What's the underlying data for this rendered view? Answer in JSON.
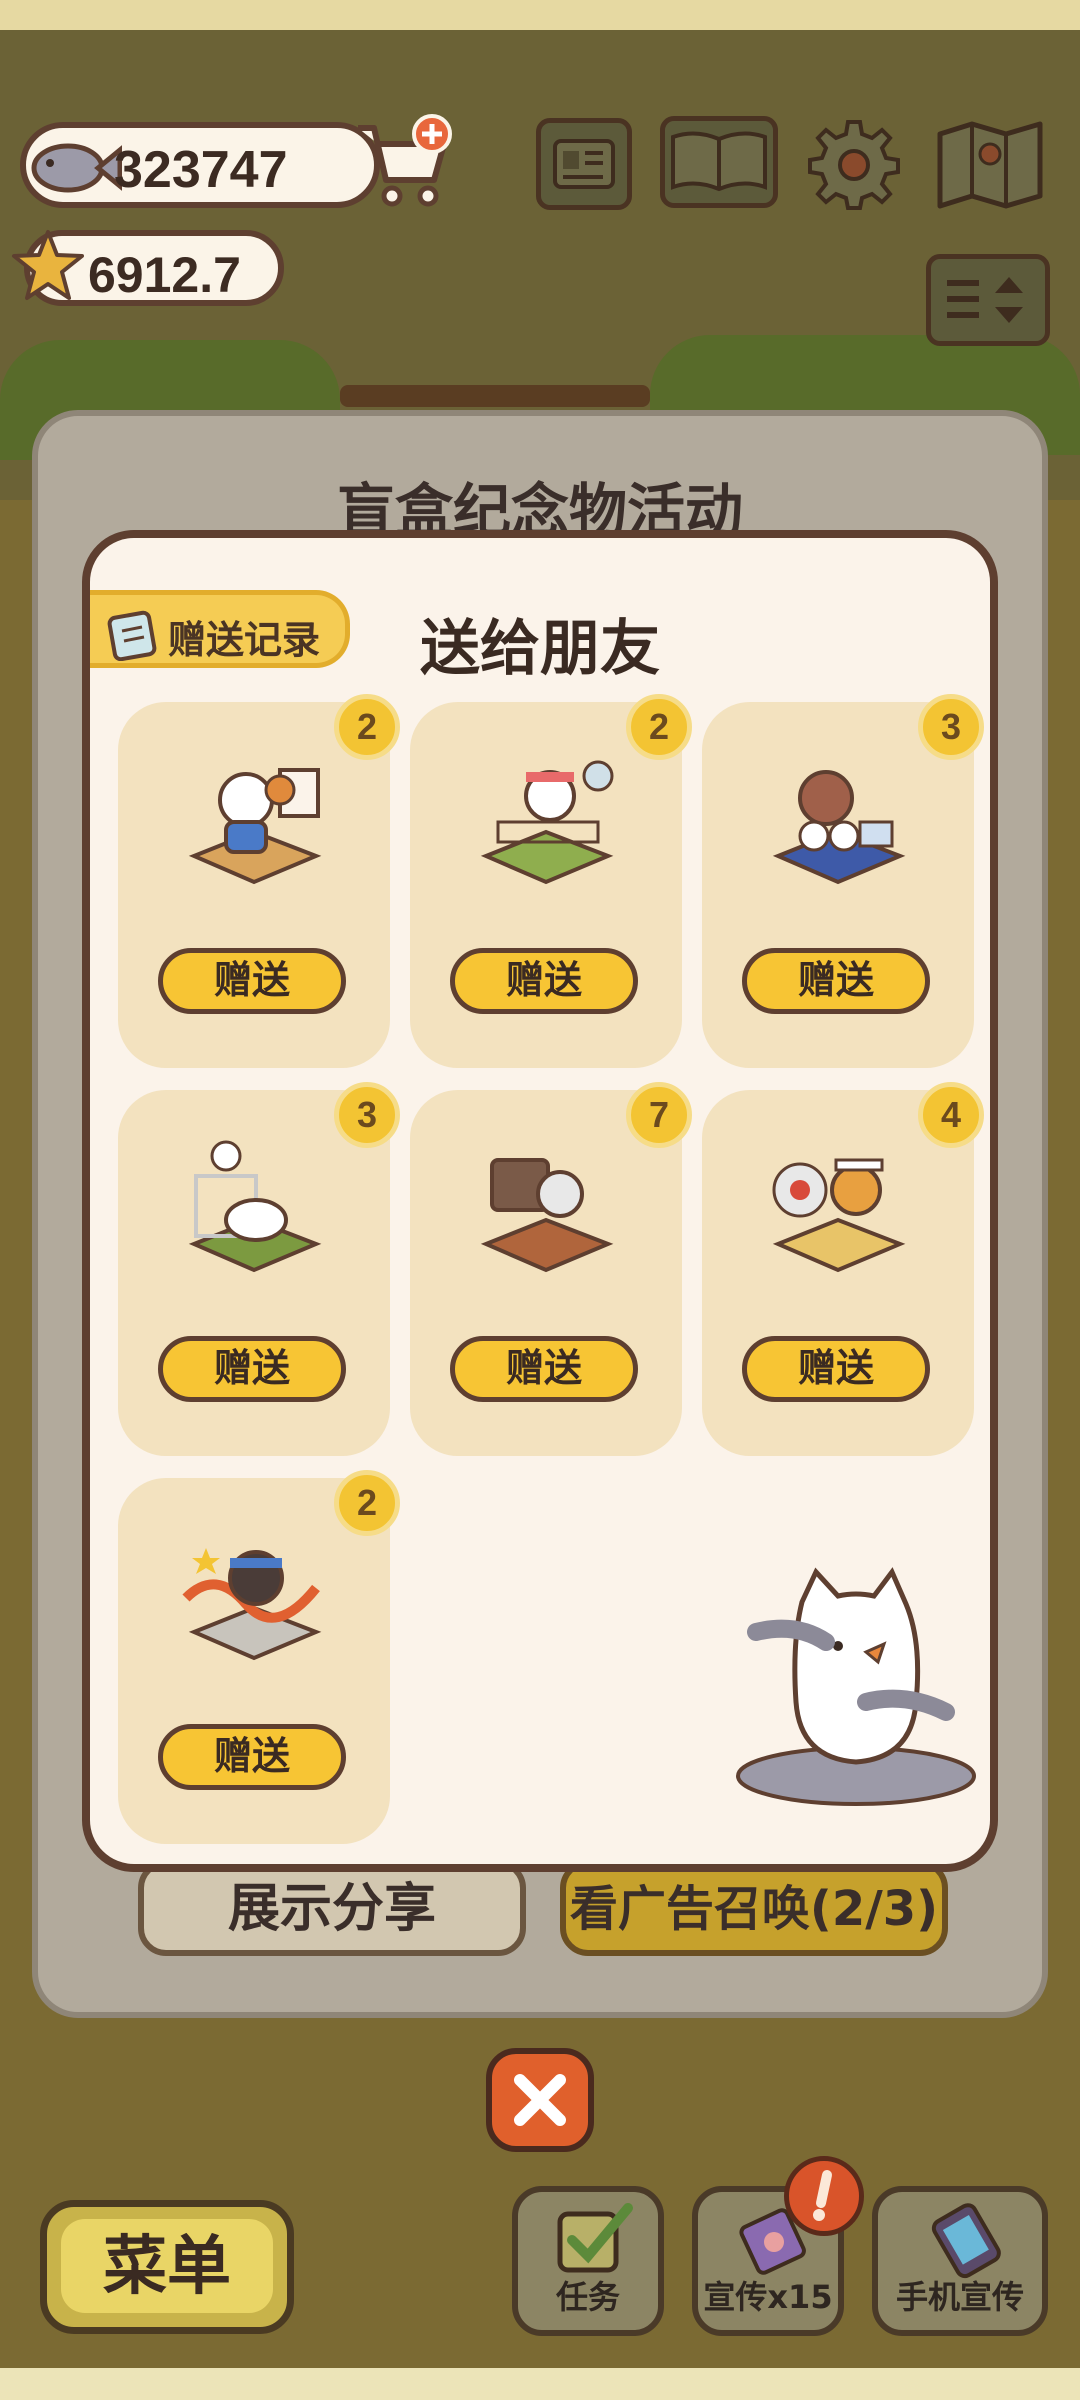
{
  "hud": {
    "fish_count": "323747",
    "star_count": "6912.7"
  },
  "back_panel": {
    "title": "盲盒纪念物活动",
    "share_button": "展示分享",
    "ad_button": "看广告召唤(2/3)"
  },
  "modal": {
    "title": "送给朋友",
    "record_tab": "赠送记录",
    "items": [
      {
        "count": "2",
        "button": "赠送"
      },
      {
        "count": "2",
        "button": "赠送"
      },
      {
        "count": "3",
        "button": "赠送"
      },
      {
        "count": "3",
        "button": "赠送"
      },
      {
        "count": "7",
        "button": "赠送"
      },
      {
        "count": "4",
        "button": "赠送"
      },
      {
        "count": "2",
        "button": "赠送"
      }
    ]
  },
  "bottom_bar": {
    "menu": "菜单",
    "tasks": "任务",
    "promote": "宣传x15",
    "phone_promote": "手机宣传"
  },
  "colors": {
    "accent_yellow": "#f7c534",
    "outline_brown": "#5e3f30",
    "close_orange": "#e0602c",
    "card_bg": "#f3e2bf"
  }
}
